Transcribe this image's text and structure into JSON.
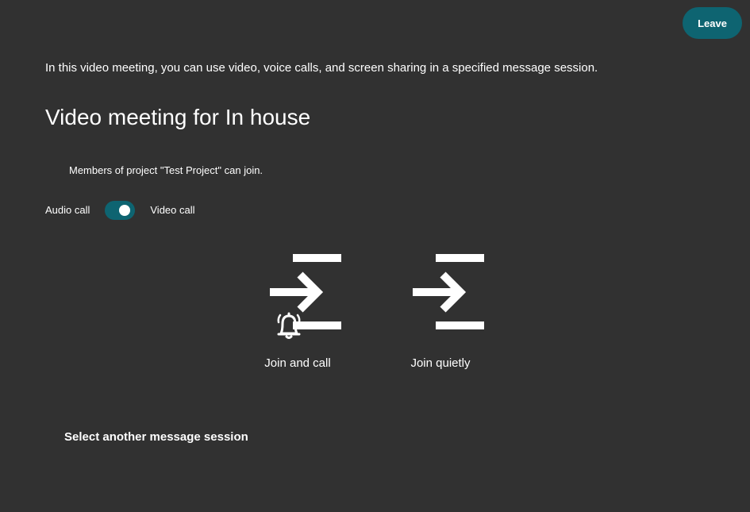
{
  "header": {
    "leave_label": "Leave"
  },
  "main": {
    "description": "In this video meeting, you can use video, voice calls, and screen sharing in a specified message session.",
    "title": "Video meeting for In house",
    "members_note": "Members of project \"Test Project\" can join.",
    "call_mode": {
      "left_label": "Audio call",
      "right_label": "Video call",
      "selected": "Video call"
    },
    "join_options": [
      {
        "label": "Join and call",
        "icon": "enter-with-bell-icon"
      },
      {
        "label": "Join quietly",
        "icon": "enter-icon"
      }
    ],
    "another_session_label": "Select another message session"
  },
  "colors": {
    "background": "#313131",
    "accent": "#0e6471",
    "text": "#ffffff"
  }
}
